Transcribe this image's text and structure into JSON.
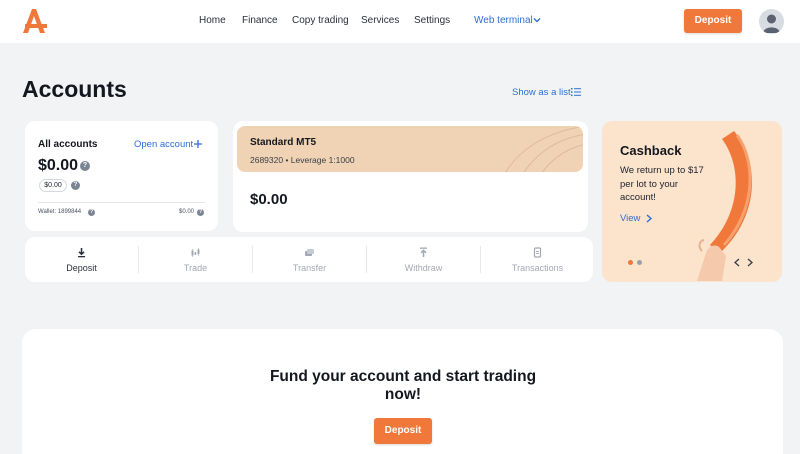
{
  "colors": {
    "accent": "#f0783a",
    "link": "#2f6fd1",
    "mt5_header": "#efd3b4",
    "cashback_bg": "#fbe3cc"
  },
  "header": {
    "logo_icon": "brand-logo-icon",
    "nav": [
      {
        "label": "Home"
      },
      {
        "label": "Finance"
      },
      {
        "label": "Copy trading"
      },
      {
        "label": "Services"
      },
      {
        "label": "Settings"
      }
    ],
    "web_terminal": "Web terminal",
    "deposit_label": "Deposit",
    "avatar_icon": "user-avatar-icon"
  },
  "page": {
    "title": "Accounts",
    "show_as_list": "Show as a list"
  },
  "all_accounts": {
    "title": "All accounts",
    "open_account": "Open account",
    "total": "$0.00",
    "pill": "$0.00",
    "wallet_label": "Wallet: 1899844",
    "wallet_amount": "$0.00"
  },
  "mt5_account": {
    "name": "Standard MT5",
    "meta": "2689320 • Leverage 1:1000",
    "balance": "$0.00"
  },
  "actions": [
    {
      "label": "Deposit",
      "icon": "download-icon"
    },
    {
      "label": "Trade",
      "icon": "candlestick-icon"
    },
    {
      "label": "Transfer",
      "icon": "transfer-icon"
    },
    {
      "label": "Withdraw",
      "icon": "upload-icon"
    },
    {
      "label": "Transactions",
      "icon": "document-icon"
    }
  ],
  "cashback": {
    "title": "Cashback",
    "text": "We return up to $17 per lot to your account!",
    "view": "View",
    "slide_current": 1,
    "slide_count": 2
  },
  "fund": {
    "title": "Fund your account and start trading now!",
    "deposit_label": "Deposit"
  }
}
